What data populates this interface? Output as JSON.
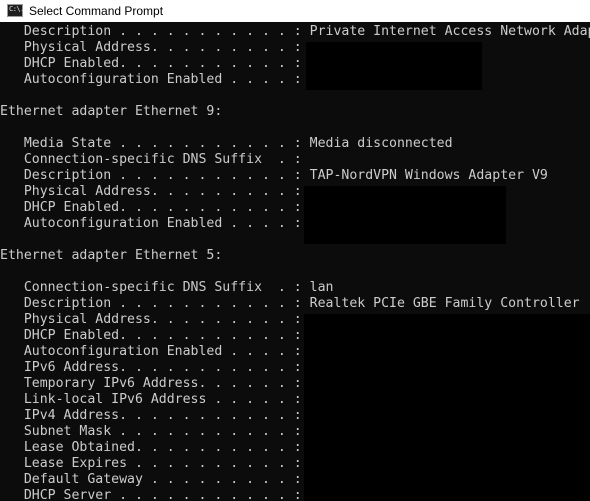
{
  "window": {
    "title": "Select Command Prompt",
    "icon": "cmd-icon",
    "icon_text": "C:\\."
  },
  "console_lines": [
    "   Description . . . . . . . . . . . : Private Internet Access Network Adapter",
    "   Physical Address. . . . . . . . . :",
    "   DHCP Enabled. . . . . . . . . . . :",
    "   Autoconfiguration Enabled . . . . :",
    "",
    "Ethernet adapter Ethernet 9:",
    "",
    "   Media State . . . . . . . . . . . : Media disconnected",
    "   Connection-specific DNS Suffix  . :",
    "   Description . . . . . . . . . . . : TAP-NordVPN Windows Adapter V9",
    "   Physical Address. . . . . . . . . :",
    "   DHCP Enabled. . . . . . . . . . . :",
    "   Autoconfiguration Enabled . . . . :",
    "",
    "Ethernet adapter Ethernet 5:",
    "",
    "   Connection-specific DNS Suffix  . : lan",
    "   Description . . . . . . . . . . . : Realtek PCIe GBE Family Controller",
    "   Physical Address. . . . . . . . . :",
    "   DHCP Enabled. . . . . . . . . . . :",
    "   Autoconfiguration Enabled . . . . :",
    "   IPv6 Address. . . . . . . . . . . :",
    "   Temporary IPv6 Address. . . . . . :",
    "   Link-local IPv6 Address . . . . . :",
    "   IPv4 Address. . . . . . . . . . . :",
    "   Subnet Mask . . . . . . . . . . . :",
    "   Lease Obtained. . . . . . . . . . :",
    "   Lease Expires . . . . . . . . . . :",
    "   Default Gateway . . . . . . . . . :",
    "   DHCP Server . . . . . . . . . . . :"
  ],
  "colors": {
    "console_background": "#0c0c0c",
    "console_text": "#cccccc",
    "redaction": "#000000",
    "titlebar": "#ffffff"
  }
}
